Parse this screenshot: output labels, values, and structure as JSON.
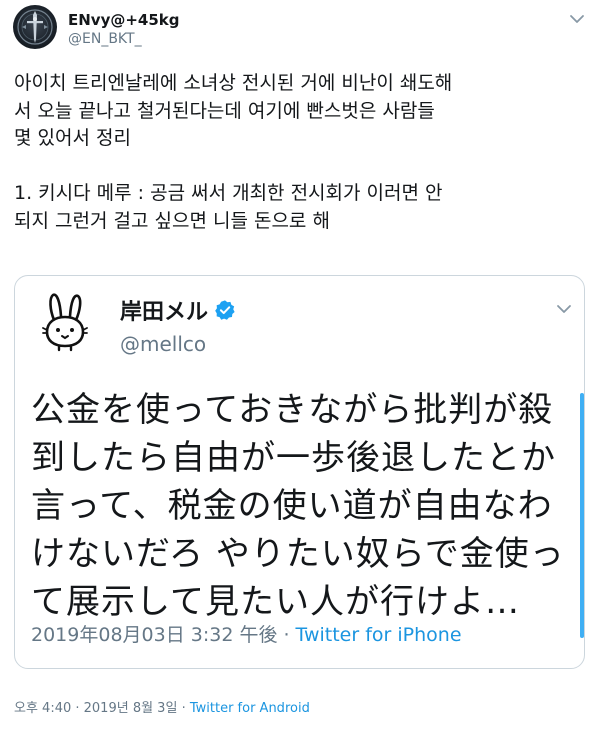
{
  "author": {
    "display_name": "ENvy@+45kg",
    "handle": "@EN_BKT_",
    "avatar_icon": "sword-emblem-avatar",
    "menu_icon": "chevron-down-icon"
  },
  "tweet": {
    "lines": [
      "아이치 트리엔날레에 소녀상 전시된 거에 비난이 쇄도해",
      "서 오늘 끝나고 철거된다는데 여기에 빤스벗은 사람들",
      "몇 있어서 정리",
      "1. 키시다 메루 : 공금 써서 개최한 전시회가 이러면 안",
      "되지 그런거 걸고 싶으면 니들 돈으로 해"
    ]
  },
  "quoted": {
    "display_name": "岸田メル",
    "handle": "@mellco",
    "verified_icon": "verified-badge-icon",
    "avatar_icon": "rabbit-avatar",
    "lines": [
      "公金を使っておきながら批判が殺",
      "到したら自由が一歩後退したとか",
      "言って、税金の使い道が自由なわ",
      "けないだろ やりたい奴らで金使っ",
      "て展示して見たい人が行けよ…"
    ],
    "timestamp": "2019年08月03日 3:32 午後",
    "separator": "·",
    "source": "Twitter for iPhone"
  },
  "footer": {
    "timestamp": "오후 4:40 · 2019년 8월 3일",
    "separator": "·",
    "source": "Twitter for Android"
  },
  "colors": {
    "text": "#14171a",
    "secondary": "#657786",
    "link": "#1b95e0",
    "border": "#ccd6dd",
    "verified": "#1da1f2"
  }
}
